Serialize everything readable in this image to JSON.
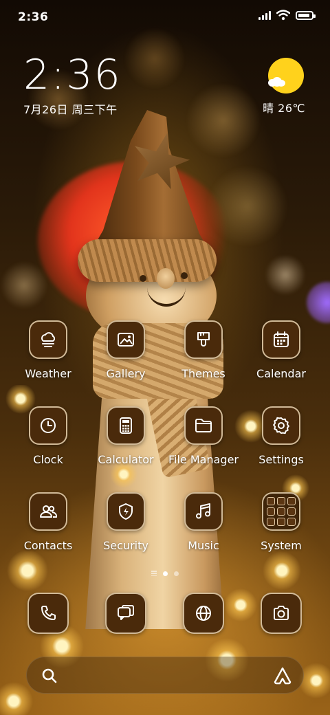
{
  "status_bar": {
    "time": "2:36",
    "battery_level": 0.9,
    "signal_bars": 4,
    "icons": [
      "signal-icon",
      "wifi-icon",
      "battery-icon"
    ]
  },
  "clock_widget": {
    "time": "2:36",
    "date": "7月26日 周三下午"
  },
  "weather_widget": {
    "icon": "partly-sunny-icon",
    "text": "晴 26℃",
    "sun_color": "#ffd21c"
  },
  "apps": [
    {
      "label": "Weather",
      "icon": "weather-icon"
    },
    {
      "label": "Gallery",
      "icon": "gallery-icon"
    },
    {
      "label": "Themes",
      "icon": "themes-icon"
    },
    {
      "label": "Calendar",
      "icon": "calendar-icon"
    },
    {
      "label": "Clock",
      "icon": "clock-icon"
    },
    {
      "label": "Calculator",
      "icon": "calculator-icon"
    },
    {
      "label": "File Manager",
      "icon": "folder-icon"
    },
    {
      "label": "Settings",
      "icon": "gear-icon"
    },
    {
      "label": "Contacts",
      "icon": "contacts-icon"
    },
    {
      "label": "Security",
      "icon": "shield-icon"
    },
    {
      "label": "Music",
      "icon": "music-note-icon"
    },
    {
      "label": "System",
      "icon": "app-folder-icon"
    }
  ],
  "page_indicator": {
    "pages": 2,
    "current": 1
  },
  "dock": [
    {
      "icon": "phone-icon"
    },
    {
      "icon": "messages-icon"
    },
    {
      "icon": "browser-globe-icon"
    },
    {
      "icon": "camera-icon"
    }
  ],
  "search_bar": {
    "left_icon": "search-icon",
    "right_icon": "assistant-icon"
  },
  "theme": {
    "tile_background": "#4a2a0b",
    "tile_border": "#ffebc8",
    "text": "#ffffff"
  }
}
